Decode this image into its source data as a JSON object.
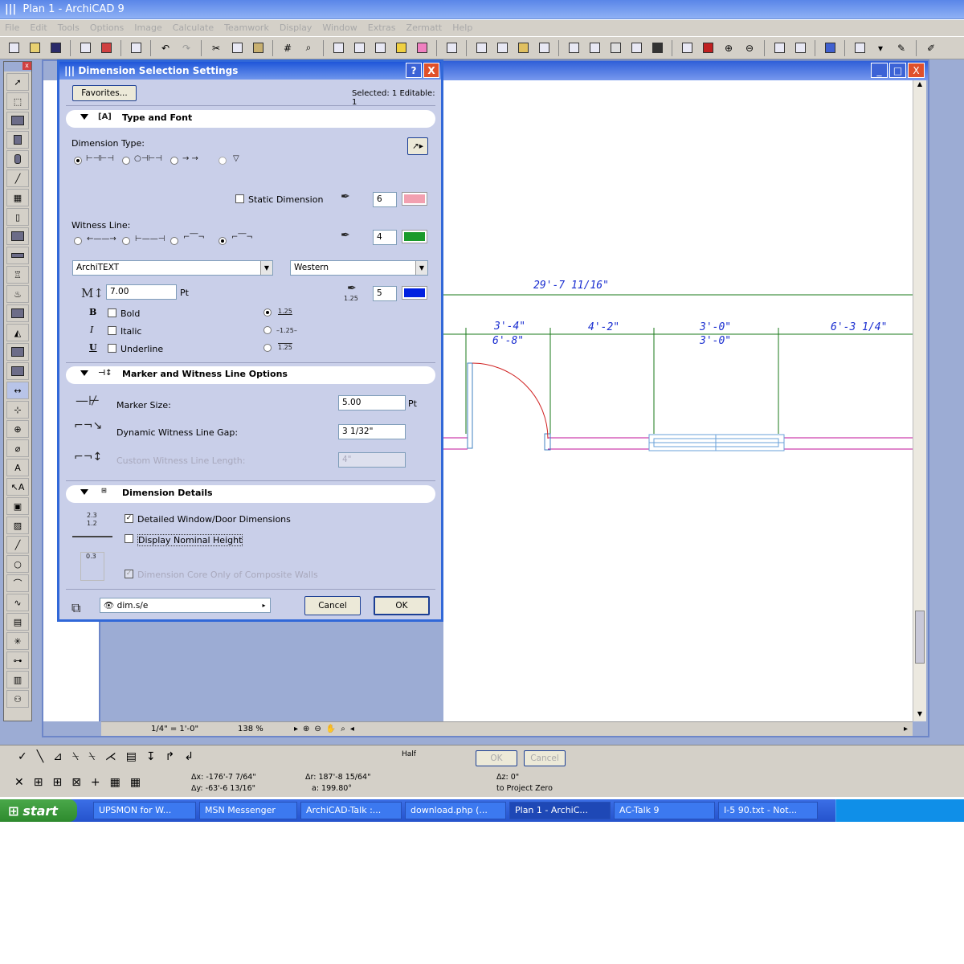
{
  "app": {
    "title": "Plan 1 - ArchiCAD 9"
  },
  "menu": [
    "File",
    "Edit",
    "Tools",
    "Options",
    "Image",
    "Calculate",
    "Teamwork",
    "Display",
    "Window",
    "Extras",
    "Zermatt",
    "Help"
  ],
  "dialog": {
    "title": "Dimension Selection Settings",
    "help_btn": "?",
    "close_btn": "X",
    "favorites_label": "Favorites...",
    "selected_info": "Selected: 1 Editable: 1",
    "section_type_font": "Type and Font",
    "dimension_type_label": "Dimension Type:",
    "static_dimension_label": "Static Dimension",
    "static_dimension_checked": false,
    "pen_dimension": "6",
    "witness_line_label": "Witness Line:",
    "pen_witness": "4",
    "font_name": "ArchiTEXT",
    "font_script": "Western",
    "font_size": "7.00",
    "font_size_unit": "Pt",
    "pen_text": "5",
    "pen_text_weight": "1.25",
    "bold_label": "Bold",
    "italic_label": "Italic",
    "underline_label": "Underline",
    "bold_key": "B",
    "italic_key": "I",
    "underline_key": "U",
    "text_pos_sample": "1.25",
    "text_pos_sample_mid": "–1.25–",
    "section_marker": "Marker and Witness Line Options",
    "marker_size_label": "Marker Size:",
    "marker_size_value": "5.00",
    "marker_size_unit": "Pt",
    "gap_label": "Dynamic Witness Line Gap:",
    "gap_value": "3 1/32\"",
    "custom_length_label": "Custom Witness Line Length:",
    "custom_length_value": "4\"",
    "section_details": "Dimension Details",
    "detail_icon_top": "2.3",
    "detail_icon_bottom": "1.2",
    "detail_icon_mid": "0.3",
    "detailed_label": "Detailed Window/Door Dimensions",
    "detailed_checked": true,
    "nominal_label": "Display Nominal Height",
    "nominal_checked": false,
    "core_label": "Dimension Core Only of Composite Walls",
    "core_checked": true,
    "layer_value": "dim.s/e",
    "cancel_label": "Cancel",
    "ok_label": "OK",
    "colors": {
      "pen_dimension": "#f2a0b0",
      "pen_witness": "#1a9a2a",
      "pen_text": "#0020e0"
    }
  },
  "plan": {
    "window_buttons": [
      "_",
      "□",
      "X"
    ],
    "dims": {
      "overall": "29'-7 11/16\"",
      "d1_top": "3'-4\"",
      "d1_bottom": "6'-8\"",
      "d2": "4'-2\"",
      "d3_top": "3'-0\"",
      "d3_bottom": "3'-0\"",
      "d4": "6'-3 1/4\""
    },
    "scale": "1/4\"  =  1'-0\"",
    "zoom": "138 %"
  },
  "infobox": {
    "dx": "Δx: -176'-7 7/64\"",
    "dy": "Δy: -63'-6 13/16\"",
    "dr": "Δr: 187'-8 15/64\"",
    "da": "a: 199.80°",
    "dz": "Δz: 0\"",
    "zref": "to Project Zero",
    "grid_mode": "Half",
    "ok": "OK",
    "cancel": "Cancel"
  },
  "taskbar": {
    "start": "start",
    "items": [
      "UPSMON for W...",
      "MSN Messenger",
      "ArchiCAD-Talk :...",
      "download.php (...",
      "Plan 1 - ArchiC...",
      "AC-Talk 9",
      "I-5 90.txt - Not..."
    ],
    "active_index": 4
  }
}
